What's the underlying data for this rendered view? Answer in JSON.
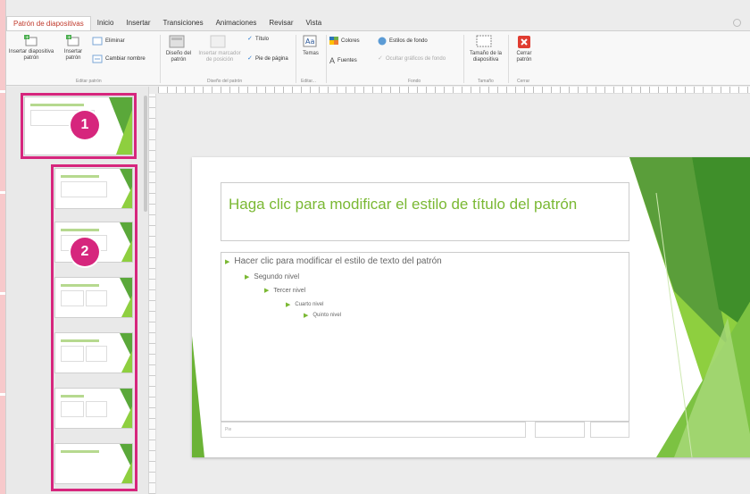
{
  "tabs": [
    {
      "label": "Patrón de diapositivas",
      "active": true
    },
    {
      "label": "Inicio"
    },
    {
      "label": "Insertar"
    },
    {
      "label": "Transiciones"
    },
    {
      "label": "Animaciones"
    },
    {
      "label": "Revisar"
    },
    {
      "label": "Vista"
    }
  ],
  "ribbon": {
    "insertar_diapositiva_patron": "Insertar diapositiva patrón",
    "insertar_patron": "Insertar patrón",
    "eliminar": "Eliminar",
    "cambiar_nombre": "Cambiar nombre",
    "grupo_editar_patron": "Editar patrón",
    "diseno_del_patron": "Diseño del patrón",
    "insertar_marcador": "Insertar marcador de posición",
    "titulo": "Título",
    "pie_de_pagina": "Pie de página",
    "grupo_diseno_del_patron": "Diseño del patrón",
    "temas": "Temas",
    "grupo_editar_tema": "Editar...",
    "colores": "Colores",
    "fuentes": "Fuentes",
    "estilos_de_fondo": "Estilos de fondo",
    "ocultar_graficos": "Ocultar gráficos de fondo",
    "grupo_fondo": "Fondo",
    "tamano_diapositiva": "Tamaño de la diapositiva",
    "grupo_tamano": "Tamaño",
    "cerrar_patron": "Cerrar patrón",
    "grupo_cerrar": "Cerrar"
  },
  "badges": {
    "one": "1",
    "two": "2"
  },
  "slide": {
    "title": "Haga clic para modificar el estilo de título del patrón",
    "levels": [
      "Hacer clic para modificar el estilo de texto del patrón",
      "Segundo nivel",
      "Tercer nivel",
      "Cuarto nivel",
      "Quinto nivel"
    ],
    "footer": "Pie"
  },
  "colors": {
    "accent_green": "#7ab833",
    "highlight": "#d6267d",
    "active_tab": "#c0392b"
  }
}
